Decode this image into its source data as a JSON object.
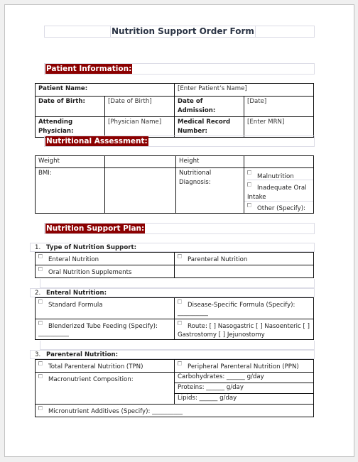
{
  "document": {
    "title": "Nutrition Support Order Form"
  },
  "patient_information": {
    "heading": "Patient Information:",
    "rows": [
      {
        "label": "Patient Name:",
        "value": "[Enter Patient’s Name]"
      },
      {
        "label1": "Date of Birth:",
        "value1": "[Date of Birth]",
        "label2": "Date of Admission:",
        "value2": "[Date]"
      },
      {
        "label1": "Attending Physician:",
        "value1": "[Physician Name]",
        "label2": "Medical Record Number:",
        "value2": "[Enter MRN]"
      }
    ]
  },
  "nutritional_assessment": {
    "heading": "Nutritional Assessment:",
    "weight_label": "Weight",
    "height_label": "Height",
    "bmi_label": "BMI:",
    "diagnosis_label": "Nutritional Diagnosis:",
    "diagnosis_options": [
      "Malnutrition",
      "Inadequate Oral Intake",
      "Other (Specify):"
    ]
  },
  "nutrition_support_plan": {
    "heading": "Nutrition Support Plan:",
    "sections": [
      {
        "number": "1.",
        "title": "Type of Nutrition Support:",
        "options": [
          "Enteral Nutrition",
          "Parenteral Nutrition",
          "Oral Nutrition Supplements"
        ]
      },
      {
        "number": "2.",
        "title": "Enteral Nutrition:",
        "options": [
          "Standard Formula",
          "Disease-Specific Formula (Specify):",
          "__________",
          "Blenderized Tube Feeding (Specify):",
          "__________",
          "Route: [ ] Nasogastric [ ] Nasoenteric [ ] Gastrostomy [ ] Jejunostomy"
        ]
      },
      {
        "number": "3.",
        "title": "Parenteral Nutrition:",
        "options": [
          "Total Parenteral Nutrition (TPN)",
          "Peripheral Parenteral Nutrition (PPN)",
          "Macronutrient Composition:",
          "Carbohydrates: ______ g/day",
          "Proteins: ______ g/day",
          "Lipids: ______ g/day",
          "Micronutrient Additives (Specify): __________"
        ]
      }
    ]
  }
}
